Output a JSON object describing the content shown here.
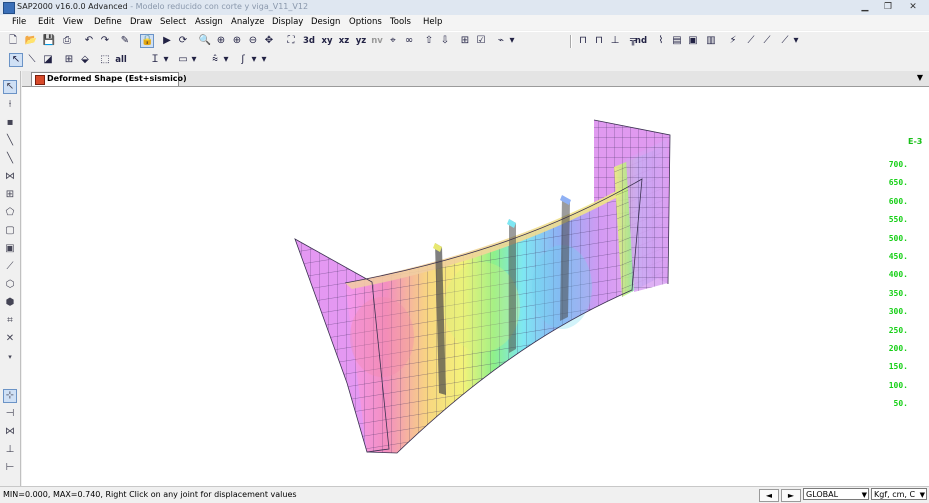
{
  "window": {
    "title_main": "SAP2000 v16.0.0 Advanced",
    "title_rest": "- Modelo reducido con corte y viga_V11_V12",
    "minimize": "▁",
    "maximize": "❐",
    "close": "✕"
  },
  "menu": [
    "File",
    "Edit",
    "View",
    "Define",
    "Draw",
    "Select",
    "Assign",
    "Analyze",
    "Display",
    "Design",
    "Options",
    "Tools",
    "Help"
  ],
  "toolbar": {
    "view_xy": "xy",
    "view_xz": "xz",
    "view_yz": "yz",
    "view_nv": "nv",
    "view_3d": "3d",
    "set_all": "all",
    "set_nd": "nd"
  },
  "tab": {
    "label": "Deformed Shape (Est+sismico)",
    "menu_arrow": "▼"
  },
  "legend": {
    "exponent": "E-3",
    "values": [
      "700.",
      "650.",
      "600.",
      "550.",
      "500.",
      "450.",
      "400.",
      "350.",
      "300.",
      "250.",
      "200.",
      "150.",
      "100.",
      "50."
    ],
    "color": "#18d018"
  },
  "status": {
    "message": "MIN=0.000, MAX=0.740, Right Click on any joint for displacement values",
    "nav_back": "◄",
    "nav_forward": "►",
    "coord_system": "GLOBAL",
    "units": "Kgf, cm, C"
  }
}
